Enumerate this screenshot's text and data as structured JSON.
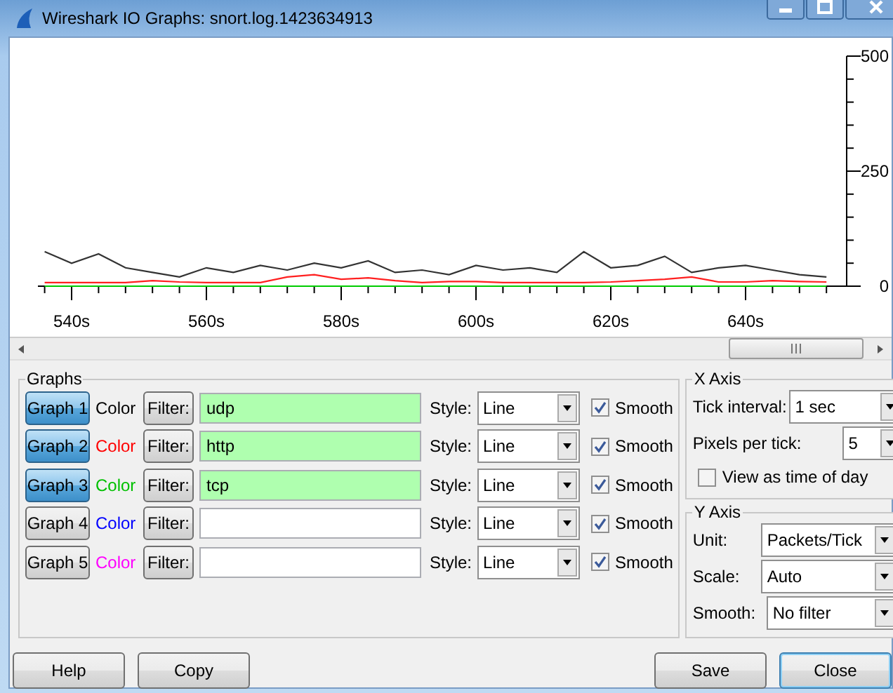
{
  "window": {
    "title": "Wireshark IO Graphs: snort.log.1423634913"
  },
  "chart": {
    "chart_data": {
      "type": "line",
      "x": [
        536,
        540,
        544,
        548,
        552,
        556,
        560,
        564,
        568,
        572,
        576,
        580,
        584,
        588,
        592,
        596,
        600,
        604,
        608,
        612,
        616,
        620,
        624,
        628,
        632,
        636,
        640,
        644,
        648,
        652
      ],
      "series": [
        {
          "color": "#333333",
          "values": [
            75,
            50,
            70,
            40,
            30,
            20,
            40,
            30,
            45,
            35,
            50,
            40,
            55,
            30,
            35,
            25,
            45,
            35,
            40,
            30,
            75,
            40,
            45,
            65,
            30,
            40,
            45,
            35,
            25,
            20
          ]
        },
        {
          "color": "#ff2020",
          "values": [
            8,
            8,
            8,
            8,
            12,
            9,
            8,
            8,
            8,
            20,
            25,
            15,
            18,
            12,
            8,
            10,
            10,
            8,
            8,
            8,
            8,
            9,
            12,
            15,
            20,
            9,
            9,
            12,
            10,
            9
          ]
        },
        {
          "color": "#00cc00",
          "values": [
            0,
            0,
            0,
            0,
            0,
            0,
            0,
            0,
            0,
            0,
            0,
            0,
            0,
            0,
            0,
            0,
            0,
            0,
            0,
            0,
            0,
            0,
            0,
            0,
            0,
            0,
            0,
            0,
            0,
            0
          ]
        }
      ],
      "xlim": [
        535,
        655
      ],
      "ylim": [
        0,
        500
      ],
      "xticks": [
        {
          "value": 540,
          "label": "540s"
        },
        {
          "value": 560,
          "label": "560s"
        },
        {
          "value": 580,
          "label": "580s"
        },
        {
          "value": 600,
          "label": "600s"
        },
        {
          "value": 620,
          "label": "620s"
        },
        {
          "value": 640,
          "label": "640s"
        }
      ],
      "yticks": [
        0,
        250,
        500
      ]
    }
  },
  "graphs_group": {
    "title": "Graphs",
    "rows": [
      {
        "button": "Graph 1",
        "selected": true,
        "color_label": "Color",
        "color": "#000000",
        "filter_button": "Filter:",
        "filter": "udp",
        "filter_valid": true,
        "style_label": "Style:",
        "style": "Line",
        "smooth_label": "Smooth",
        "smooth": true
      },
      {
        "button": "Graph 2",
        "selected": true,
        "color_label": "Color",
        "color": "#ff0000",
        "filter_button": "Filter:",
        "filter": "http",
        "filter_valid": true,
        "style_label": "Style:",
        "style": "Line",
        "smooth_label": "Smooth",
        "smooth": true
      },
      {
        "button": "Graph 3",
        "selected": true,
        "color_label": "Color",
        "color": "#00c000",
        "filter_button": "Filter:",
        "filter": "tcp",
        "filter_valid": true,
        "style_label": "Style:",
        "style": "Line",
        "smooth_label": "Smooth",
        "smooth": true
      },
      {
        "button": "Graph 4",
        "selected": false,
        "color_label": "Color",
        "color": "#0000ff",
        "filter_button": "Filter:",
        "filter_valid": false,
        "style_label": "Style:",
        "style": "Line",
        "smooth_label": "Smooth",
        "smooth": true
      },
      {
        "button": "Graph 5",
        "selected": false,
        "color_label": "Color",
        "color": "#ff00ff",
        "filter_button": "Filter:",
        "filter_valid": false,
        "style_label": "Style:",
        "style": "Line",
        "smooth_label": "Smooth",
        "smooth": true
      }
    ]
  },
  "x_axis": {
    "title": "X Axis",
    "tick_interval_label": "Tick interval:",
    "tick_interval": "1 sec",
    "pixels_per_tick_label": "Pixels per tick:",
    "pixels_per_tick": "5",
    "time_of_day_label": "View as time of day",
    "time_of_day": false
  },
  "y_axis": {
    "title": "Y Axis",
    "unit_label": "Unit:",
    "unit": "Packets/Tick",
    "scale_label": "Scale:",
    "scale": "Auto",
    "smooth_label": "Smooth:",
    "smooth": "No filter"
  },
  "buttons_left": [
    {
      "label": "Help",
      "default": false
    },
    {
      "label": "Copy",
      "default": false
    }
  ],
  "buttons_right": [
    {
      "label": "Save",
      "default": false
    },
    {
      "label": "Close",
      "default": true
    }
  ]
}
